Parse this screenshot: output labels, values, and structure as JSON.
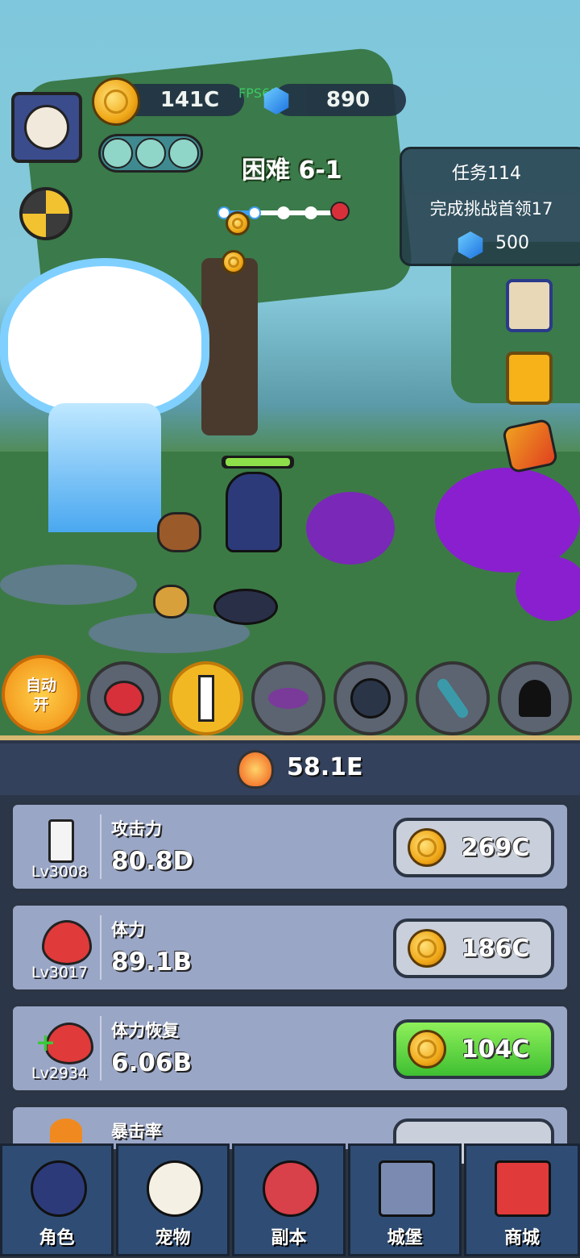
{
  "hud": {
    "coins": "141C",
    "fps": "FPS61",
    "gems": "890",
    "stage": "困难 6-1"
  },
  "quest": {
    "title": "任务114",
    "desc": "完成挑战首领17",
    "reward": "500"
  },
  "auto_button": {
    "line1": "自动",
    "line2": "开"
  },
  "power": "58.1E",
  "upgrades": [
    {
      "name": "攻击力",
      "value": "80.8D",
      "level": "Lv3008",
      "cost": "269C",
      "icon": "sword-icon"
    },
    {
      "name": "体力",
      "value": "89.1B",
      "level": "Lv3017",
      "cost": "186C",
      "icon": "heart-icon"
    },
    {
      "name": "体力恢复",
      "value": "6.06B",
      "level": "Lv2934",
      "cost": "104C",
      "icon": "heart-plus-icon"
    },
    {
      "name": "暴击率",
      "value": "",
      "level": "",
      "cost": "",
      "icon": "claw-icon"
    }
  ],
  "nav": [
    {
      "label": "角色",
      "icon": "hero-icon"
    },
    {
      "label": "宠物",
      "icon": "panda-icon"
    },
    {
      "label": "副本",
      "icon": "crossed-swords-icon"
    },
    {
      "label": "城堡",
      "icon": "castle-icon"
    },
    {
      "label": "商城",
      "icon": "shop-icon"
    }
  ],
  "colors": {
    "button_green": "#4fd03a",
    "panel": "#9aa6c6",
    "nav": "#2f4d74"
  }
}
